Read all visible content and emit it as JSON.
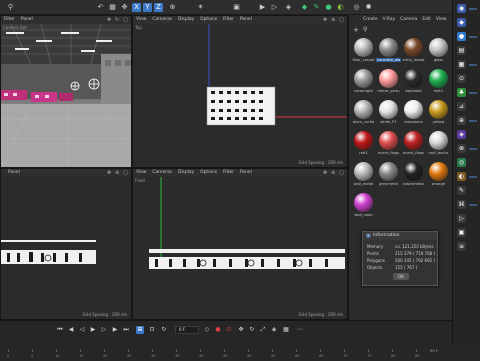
{
  "toolbar": {
    "icons": [
      "filter",
      "undo-redo",
      "grid",
      "move",
      "rotate",
      "scale",
      "keyframe",
      "render-region",
      "render-view",
      "render-settings",
      "cube",
      "pen",
      "sphere",
      "deformer",
      "camera",
      "light"
    ]
  },
  "viewports": {
    "perspective": {
      "menu": [
        "Filter",
        "Panel"
      ],
      "label": "Camera Set",
      "grid": "Grid Spacing : 20000 cm"
    },
    "top": {
      "menu": [
        "View",
        "Cameras",
        "Display",
        "Options",
        "Filter",
        "Panel"
      ],
      "label": "Top",
      "grid": "Grid Spacing : 200 cm"
    },
    "right": {
      "menu": [
        "Panel"
      ],
      "grid": "Grid Spacing : 200 cm"
    },
    "front": {
      "menu": [
        "View",
        "Cameras",
        "Display",
        "Options",
        "Filter",
        "Panel"
      ],
      "label": "Front",
      "grid": "Grid Spacing : 200 cm"
    }
  },
  "materials": {
    "menu": [
      "Create",
      "V-Ray",
      "Camera",
      "Edit",
      "View"
    ],
    "items": [
      {
        "name": "floor_carpet",
        "color": "#b9b9b9"
      },
      {
        "name": "concrete_wa",
        "color": "#8e8e8e"
      },
      {
        "name": "entry_dooof",
        "color": "#7a4a2a"
      },
      {
        "name": "glass",
        "color": "#c7c7c7"
      },
      {
        "name": "ceramight",
        "color": "#9a9a9a"
      },
      {
        "name": "mirror_pictu",
        "color": "#ff9a9a"
      },
      {
        "name": "backwall",
        "color": "#2a2a2a"
      },
      {
        "name": "exit1",
        "color": "#20b050"
      },
      {
        "name": "alum_curtw",
        "color": "#b5b5b5"
      },
      {
        "name": "white_P1",
        "color": "#e5e5e5"
      },
      {
        "name": "emissions",
        "color": "#f0f0f0"
      },
      {
        "name": "yellow",
        "color": "#c89a20"
      },
      {
        "name": "red1",
        "color": "#c01818"
      },
      {
        "name": "event_flags",
        "color": "#e05050"
      },
      {
        "name": "event_flags",
        "color": "#c02020"
      },
      {
        "name": "roof_textur",
        "color": "#d8d8d8"
      },
      {
        "name": "wall_metal",
        "color": "#bcbcbc"
      },
      {
        "name": "greymetal",
        "color": "#8a8a8a"
      },
      {
        "name": "blackmetal",
        "color": "#222222"
      },
      {
        "name": "orange",
        "color": "#e07a10"
      },
      {
        "name": "wall_neon",
        "color": "#d040d0"
      }
    ]
  },
  "info_window": {
    "title": "Information",
    "rows": [
      {
        "label": "Memory",
        "value": "ca. 121.250 kBytes"
      },
      {
        "label": "Points",
        "value": "215 379 ( 719 768 )"
      },
      {
        "label": "Polygons",
        "value": "200 145 ( 792 692 )"
      },
      {
        "label": "Objects",
        "value": "155 ( 767 )"
      }
    ],
    "ok_label": "OK"
  },
  "timeline": {
    "current_frame": "0 F",
    "end_frame": "90 F",
    "ruler": [
      "0",
      "5",
      "10",
      "15",
      "20",
      "25",
      "30",
      "35",
      "40",
      "45",
      "50",
      "55",
      "60",
      "65",
      "70",
      "75",
      "80",
      "85"
    ]
  },
  "colors": {
    "accent": "#3c78c8",
    "y_axis": "#2dbe3c",
    "x_axis": "#d23c3c",
    "z_axis": "#3c50c8"
  }
}
